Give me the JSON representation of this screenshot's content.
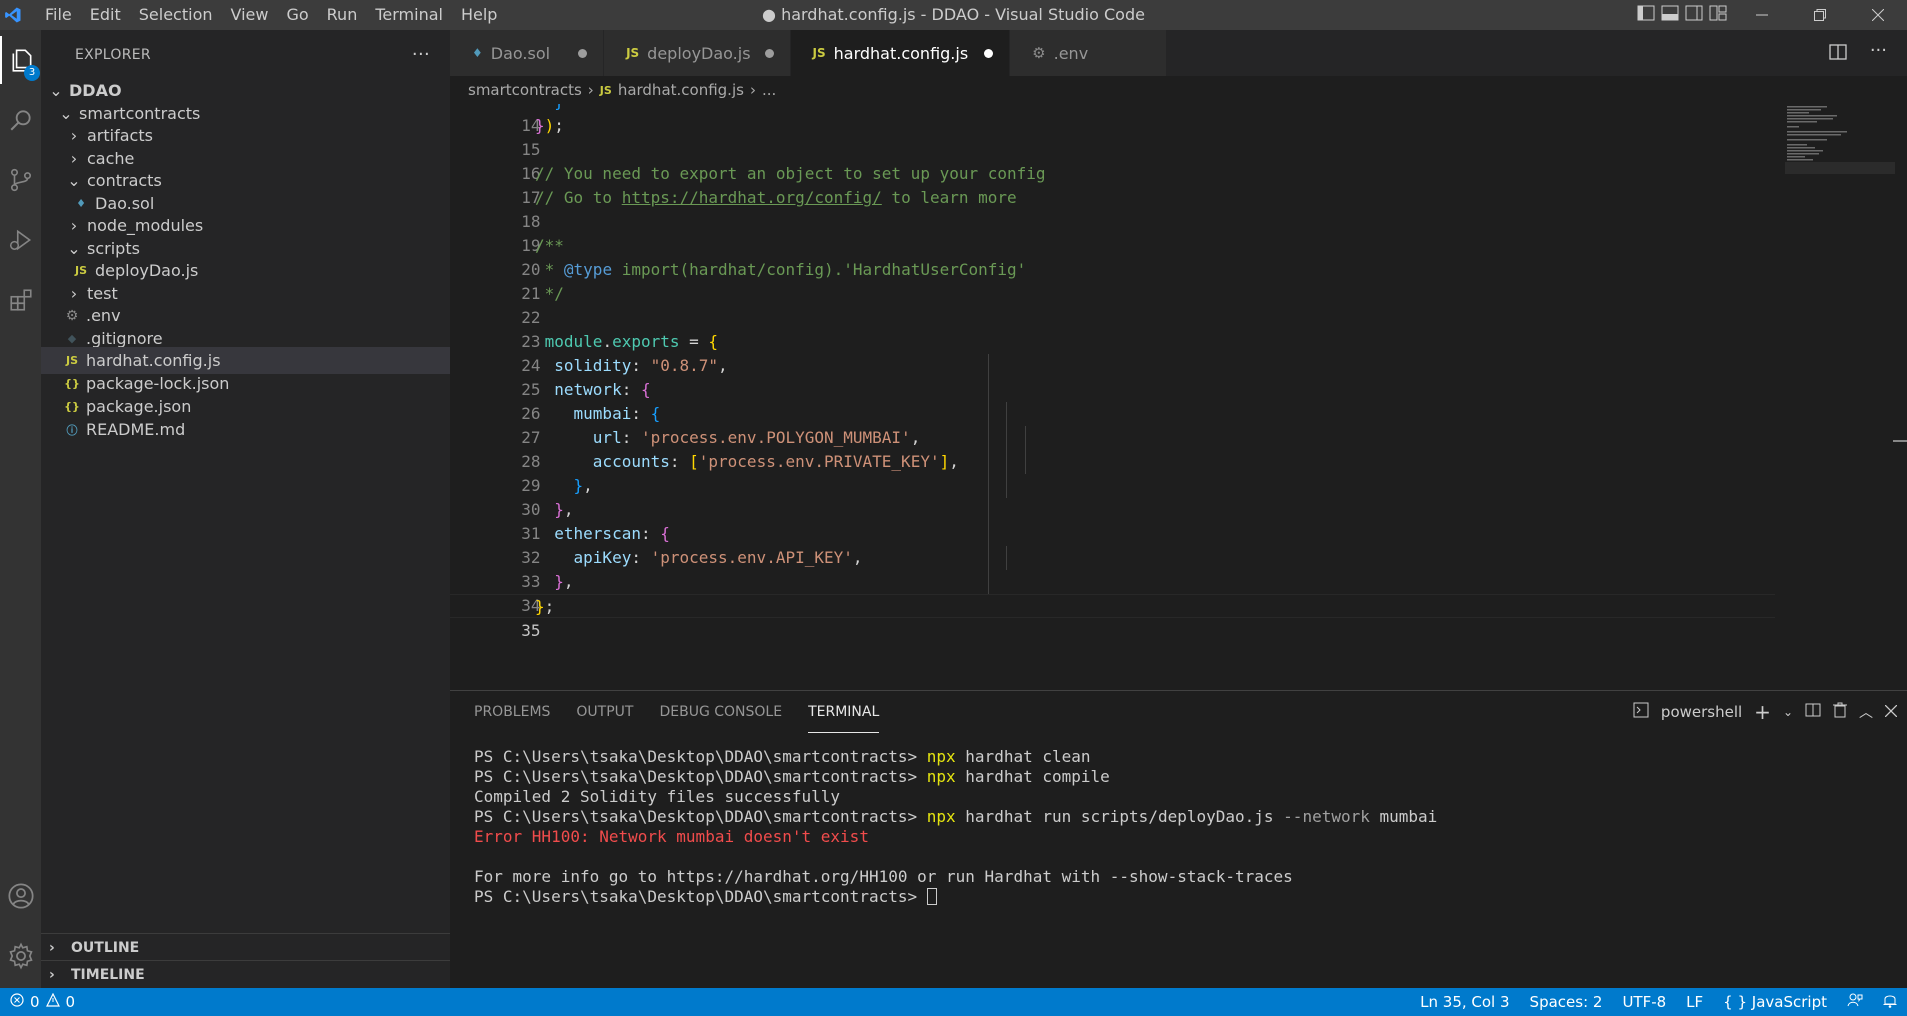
{
  "window": {
    "title": "● hardhat.config.js - DDAO - Visual Studio Code",
    "menu": [
      "File",
      "Edit",
      "Selection",
      "View",
      "Go",
      "Run",
      "Terminal",
      "Help"
    ]
  },
  "activity": {
    "explorer_badge": "3"
  },
  "explorer": {
    "header": "EXPLORER",
    "root": "DDAO",
    "items": [
      {
        "label": "smartcontracts",
        "kind": "folder-open"
      },
      {
        "label": "artifacts",
        "kind": "folder"
      },
      {
        "label": "cache",
        "kind": "folder"
      },
      {
        "label": "contracts",
        "kind": "folder-open"
      },
      {
        "label": "Dao.sol",
        "kind": "sol"
      },
      {
        "label": "node_modules",
        "kind": "folder"
      },
      {
        "label": "scripts",
        "kind": "folder-open"
      },
      {
        "label": "deployDao.js",
        "kind": "js"
      },
      {
        "label": "test",
        "kind": "folder"
      },
      {
        "label": ".env",
        "kind": "env"
      },
      {
        "label": ".gitignore",
        "kind": "git"
      },
      {
        "label": "hardhat.config.js",
        "kind": "js"
      },
      {
        "label": "package-lock.json",
        "kind": "json"
      },
      {
        "label": "package.json",
        "kind": "json"
      },
      {
        "label": "README.md",
        "kind": "info"
      }
    ],
    "outline": "OUTLINE",
    "timeline": "TIMELINE"
  },
  "tabs": [
    {
      "label": "Dao.sol",
      "icon": "sol"
    },
    {
      "label": "deployDao.js",
      "icon": "JS"
    },
    {
      "label": "hardhat.config.js",
      "icon": "JS"
    },
    {
      "label": ".env",
      "icon": "gear"
    }
  ],
  "breadcrumb": {
    "folder": "smartcontracts",
    "file": "hardhat.config.js",
    "rest": "..."
  },
  "code": {
    "line_numbers": [
      "14",
      "15",
      "16",
      "17",
      "18",
      "19",
      "20",
      "21",
      "22",
      "23",
      "24",
      "25",
      "26",
      "27",
      "28",
      "29",
      "30",
      "31",
      "32",
      "33",
      "34",
      "35"
    ],
    "comment1": "// You need to export an object to set up your config",
    "comment2_prefix": "// Go to ",
    "comment2_link": "https://hardhat.org/config/",
    "comment2_suffix": " to learn more",
    "jsdoc_open": "/**",
    "jsdoc_star": " * ",
    "jsdoc_tag": "@type",
    "jsdoc_import": " import(hardhat/config).",
    "jsdoc_type": "'HardhatUserConfig'",
    "jsdoc_close": " */",
    "module": "module",
    "exports": "exports",
    "solidity_key": "solidity",
    "solidity_val": "\"0.8.7\"",
    "network_key": "network",
    "mumbai_key": "mumbai",
    "url_key": "url",
    "url_val": "'process.env.POLYGON_MUMBAI'",
    "accounts_key": "accounts",
    "accounts_val": "'process.env.PRIVATE_KEY'",
    "etherscan_key": "etherscan",
    "apikey_key": "apiKey",
    "apikey_val": "'process.env.API_KEY'"
  },
  "panel": {
    "tabs": [
      "PROBLEMS",
      "OUTPUT",
      "DEBUG CONSOLE",
      "TERMINAL"
    ],
    "shell": "powershell",
    "prompt": "PS C:\\Users\\tsaka\\Desktop\\DDAO\\smartcontracts> ",
    "cmd1_bin": "npx",
    "cmd1_rest": " hardhat clean",
    "cmd2_bin": "npx",
    "cmd2_rest": " hardhat compile",
    "out1": "Compiled 2 Solidity files successfully",
    "cmd3_bin": "npx",
    "cmd3_rest": " hardhat run scripts/deployDao.js ",
    "cmd3_flag": "--network",
    "cmd3_arg": " mumbai",
    "error": "Error HH100: Network mumbai doesn't exist",
    "info": "For more info go to https://hardhat.org/HH100 or run Hardhat with --show-stack-traces"
  },
  "status": {
    "errors": "0",
    "warnings": "0",
    "position": "Ln 35, Col 3",
    "spaces": "Spaces: 2",
    "encoding": "UTF-8",
    "eol": "LF",
    "language": "JavaScript"
  }
}
